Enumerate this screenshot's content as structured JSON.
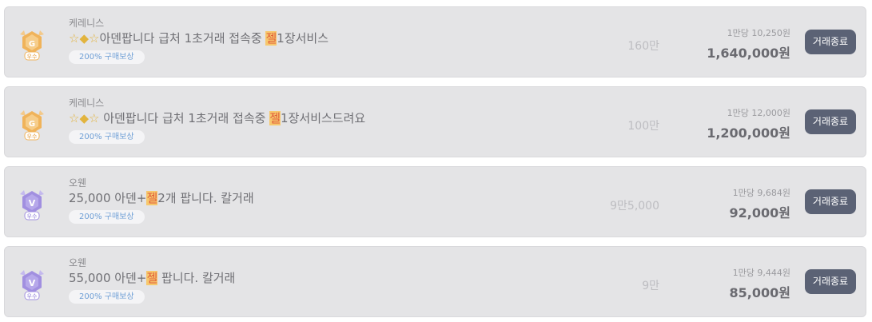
{
  "listings": [
    {
      "server": "케레니스",
      "title_prefix": "☆◆☆",
      "title_pre": "아덴팝니다 급처 1초거래 접속중 ",
      "title_highlight": "젤",
      "title_post": "1장서비스",
      "tag": "200% 구매보상",
      "quantity": "160만",
      "unit_price": "1만당 10,250원",
      "price": "1,640,000원",
      "button": "거래종료",
      "badge_letter": "G",
      "badge_label": "우수",
      "badge_color": "#f0b35a"
    },
    {
      "server": "케레니스",
      "title_prefix": "☆◆☆ ",
      "title_pre": "아덴팝니다 급처 1초거래 접속중 ",
      "title_highlight": "젤",
      "title_post": "1장서비스드려요",
      "tag": "200% 구매보상",
      "quantity": "100만",
      "unit_price": "1만당 12,000원",
      "price": "1,200,000원",
      "button": "거래종료",
      "badge_letter": "G",
      "badge_label": "우수",
      "badge_color": "#f0b35a"
    },
    {
      "server": "오웬",
      "title_prefix": "",
      "title_pre": "25,000 아덴+",
      "title_highlight": "젤",
      "title_post": "2개 팝니다. 칼거래",
      "tag": "200% 구매보상",
      "quantity": "9만5,000",
      "unit_price": "1만당 9,684원",
      "price": "92,000원",
      "button": "거래종료",
      "badge_letter": "V",
      "badge_label": "우수",
      "badge_color": "#a18fe0"
    },
    {
      "server": "오웬",
      "title_prefix": "",
      "title_pre": "55,000 아덴+",
      "title_highlight": "젤",
      "title_post": " 팝니다. 칼거래",
      "tag": "200% 구매보상",
      "quantity": "9만",
      "unit_price": "1만당 9,444원",
      "price": "85,000원",
      "button": "거래종료",
      "badge_letter": "V",
      "badge_label": "우수",
      "badge_color": "#a18fe0"
    }
  ]
}
